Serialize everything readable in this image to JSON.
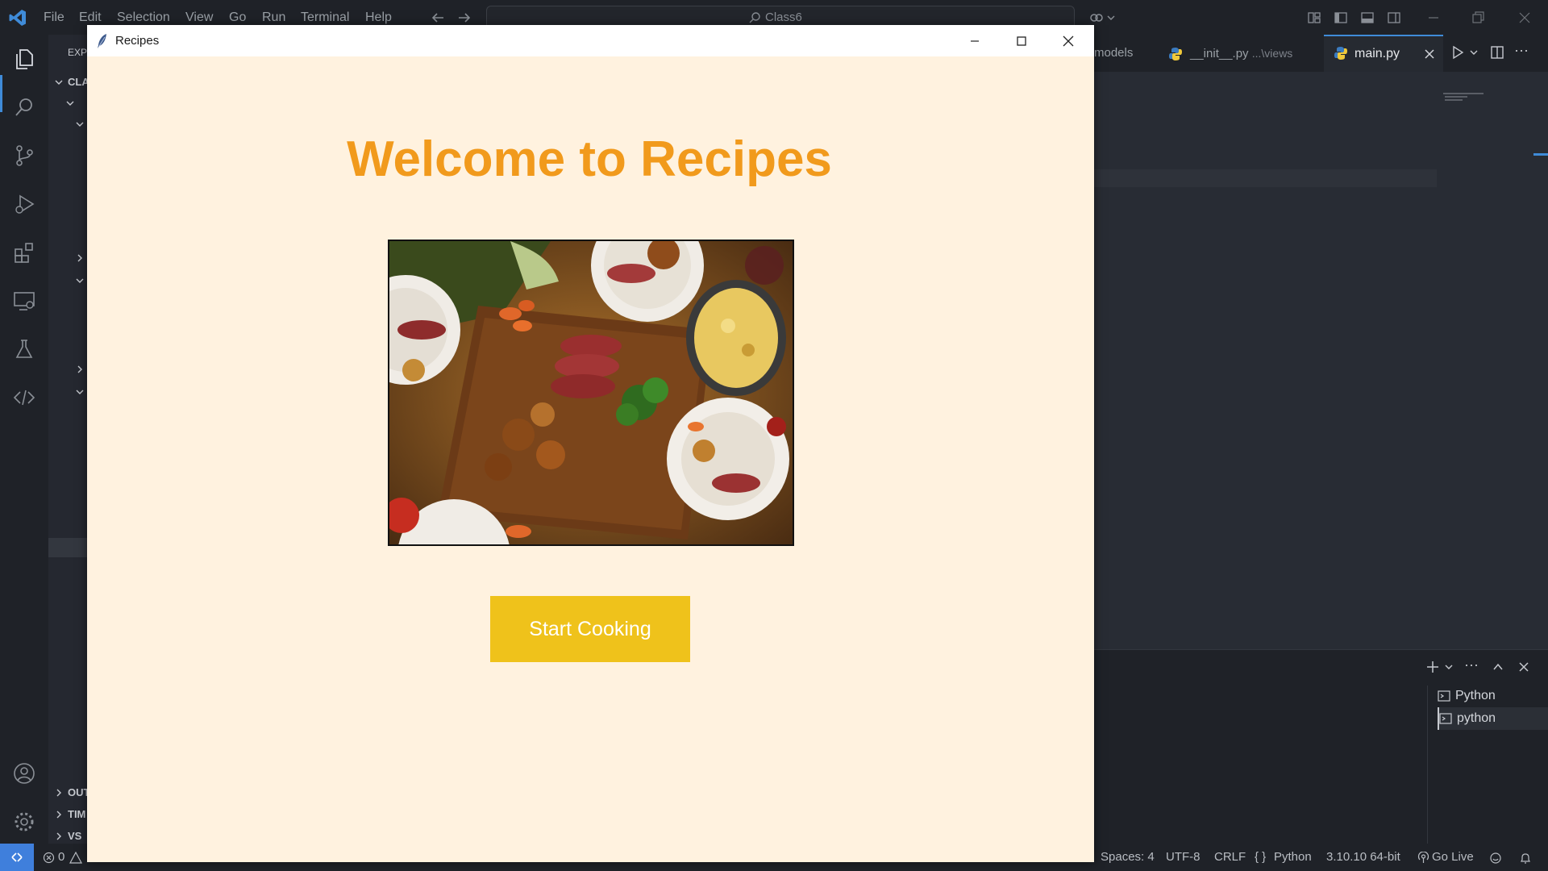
{
  "vscode": {
    "menu": [
      "File",
      "Edit",
      "Selection",
      "View",
      "Go",
      "Run",
      "Terminal",
      "Help"
    ],
    "search_placeholder": "Class6",
    "sidebar": {
      "explorer_label": "EXP",
      "folder_label": "CLA",
      "bottom_sections": [
        "OUT",
        "TIM",
        "VS"
      ]
    },
    "tabs": {
      "models": "models",
      "init_name": "__init__.py",
      "init_path": "...\\views",
      "main": "main.py"
    },
    "terminals": [
      "Python",
      "python"
    ],
    "status": {
      "errors": "0",
      "spaces": "Spaces: 4",
      "encoding": "UTF-8",
      "eol": "CRLF",
      "language": "Python",
      "interpreter": "3.10.10 64-bit",
      "go_live": "Go Live"
    },
    "colors": {
      "accent": "#3f8bd8",
      "background": "#1f2228"
    }
  },
  "app": {
    "window_title": "Recipes",
    "heading": "Welcome to Recipes",
    "button_label": "Start Cooking",
    "colors": {
      "background": "#fff2df",
      "heading": "#f19a1c",
      "button": "#efc21b",
      "button_text": "#ffffff"
    }
  }
}
